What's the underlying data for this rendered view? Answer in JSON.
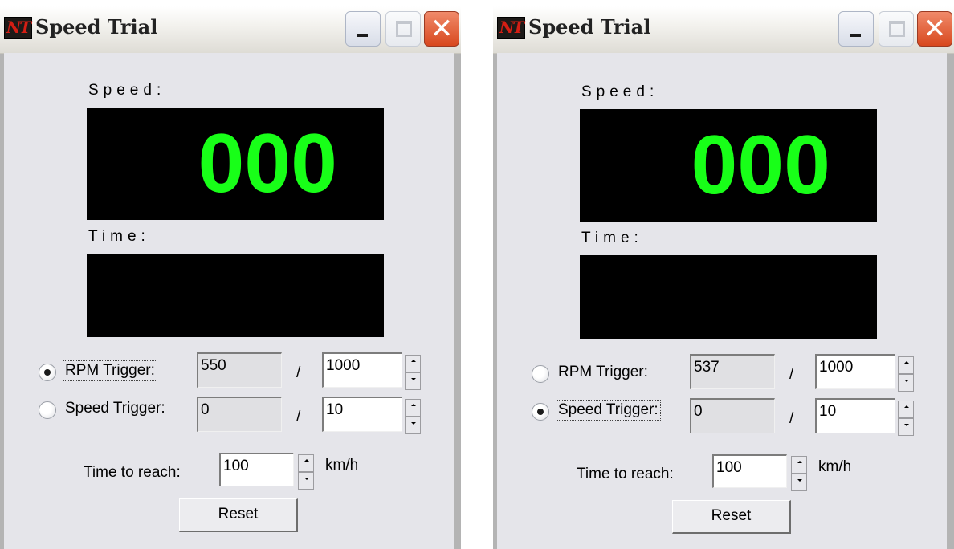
{
  "windows": [
    {
      "title": "Speed Trial",
      "app_icon_text": "NT",
      "speed_label": "Speed:",
      "speed_value": "000",
      "time_label": "Time:",
      "time_value": "",
      "rpm_trigger": {
        "label": "RPM Trigger:",
        "selected": true,
        "current": "550",
        "separator": "/",
        "target": "1000"
      },
      "speed_trigger": {
        "label": "Speed Trigger:",
        "selected": false,
        "current": "0",
        "separator": "/",
        "target": "10"
      },
      "time_to_reach": {
        "label": "Time to reach:",
        "value": "100",
        "unit": "km/h"
      },
      "reset_label": "Reset"
    },
    {
      "title": "Speed Trial",
      "app_icon_text": "NT",
      "speed_label": "Speed:",
      "speed_value": "000",
      "time_label": "Time:",
      "time_value": "",
      "rpm_trigger": {
        "label": "RPM Trigger:",
        "selected": false,
        "current": "537",
        "separator": "/",
        "target": "1000"
      },
      "speed_trigger": {
        "label": "Speed Trigger:",
        "selected": true,
        "current": "0",
        "separator": "/",
        "target": "10"
      },
      "time_to_reach": {
        "label": "Time to reach:",
        "value": "100",
        "unit": "km/h"
      },
      "reset_label": "Reset"
    }
  ],
  "colors": {
    "display_background": "#000000",
    "display_digits": "#18ff18",
    "client_background": "#e5e5ea",
    "close_button": "#d8481e"
  },
  "icons": {
    "minimize": "minimize-icon",
    "maximize": "maximize-icon",
    "close": "close-icon",
    "spin_up": "spin-up-icon",
    "spin_down": "spin-down-icon"
  },
  "glyphs": {
    "close": "✕"
  }
}
